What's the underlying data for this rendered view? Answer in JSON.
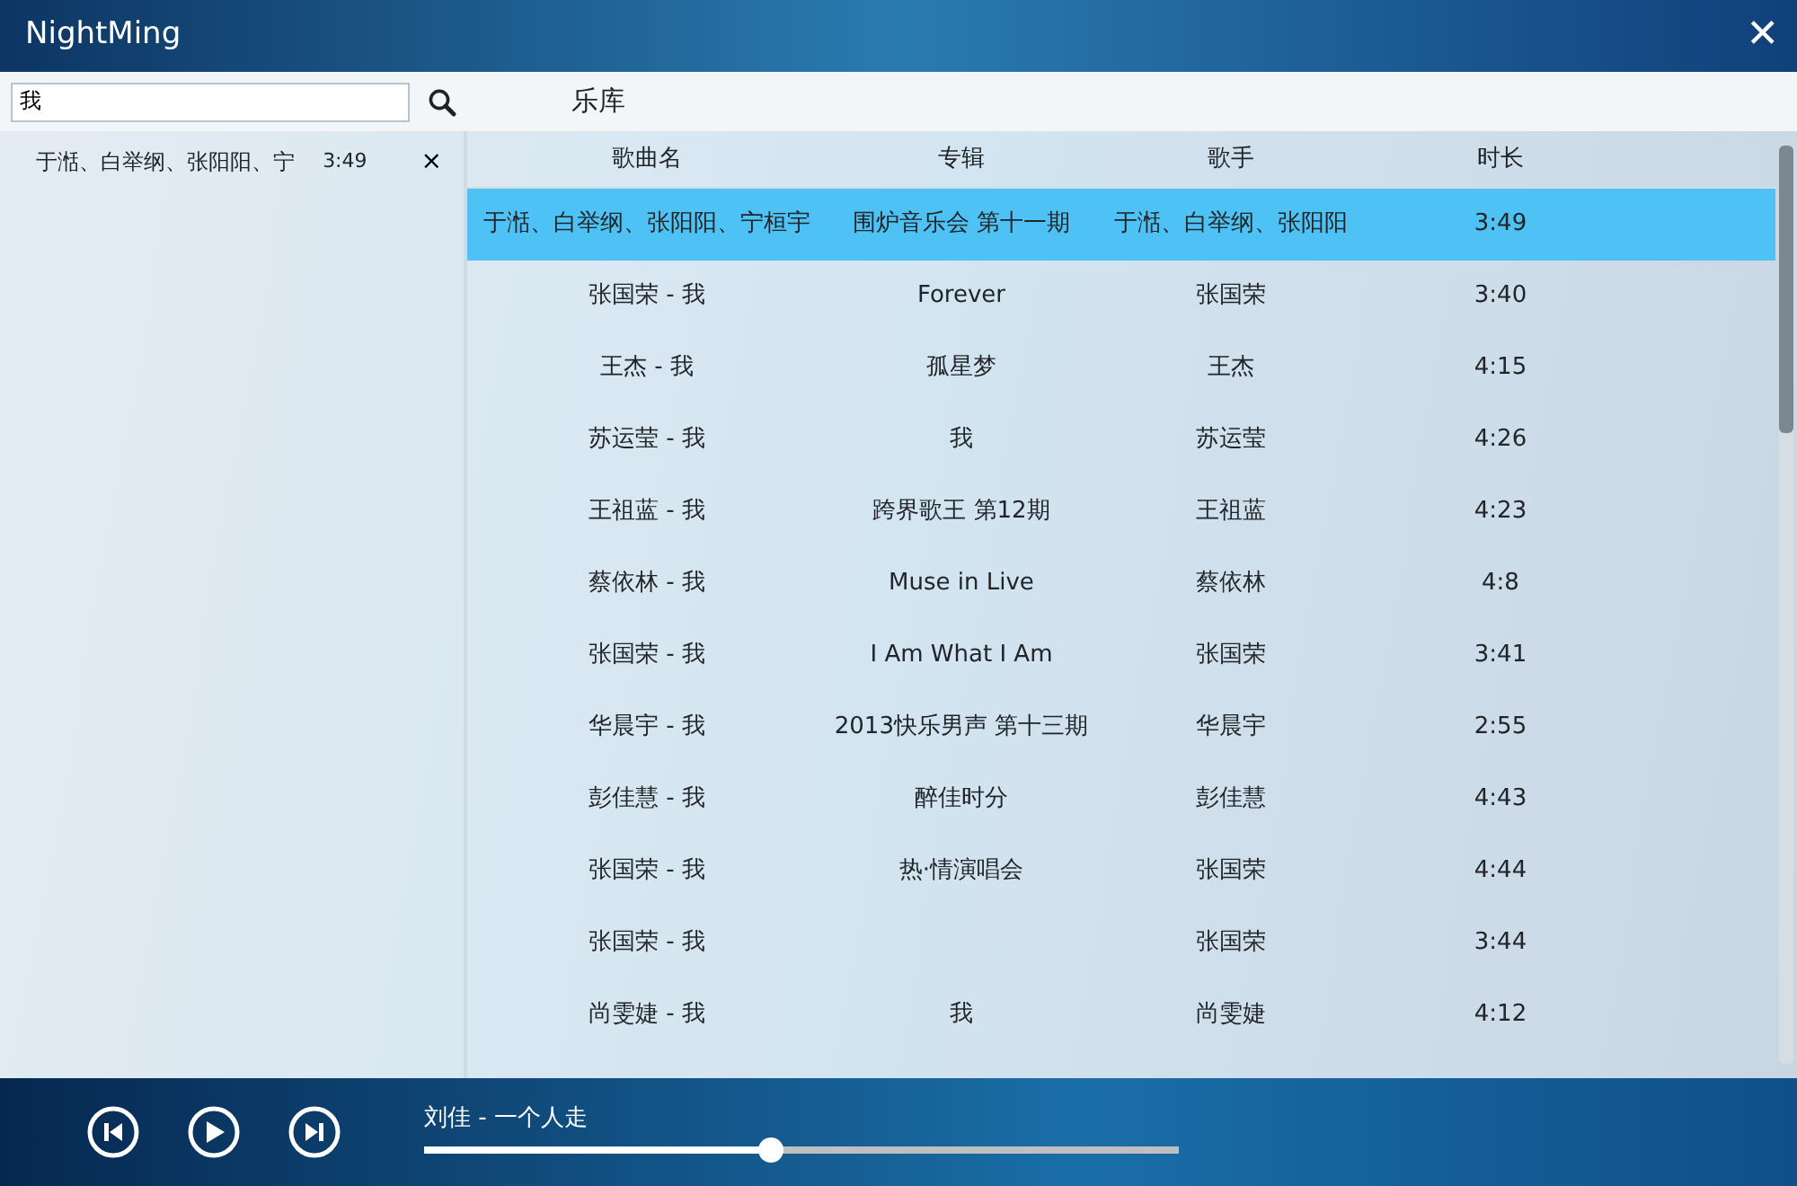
{
  "window": {
    "title": "NightMing",
    "close": "✕"
  },
  "search": {
    "value": "我"
  },
  "section_title": "乐库",
  "playlist": [
    {
      "title": "于湉、白举纲、张阳阳、宁",
      "duration": "3:49",
      "remove": "×"
    }
  ],
  "table": {
    "columns": [
      "歌曲名",
      "专辑",
      "歌手",
      "时长"
    ],
    "rows": [
      {
        "cells": [
          "于湉、白举纲、张阳阳、宁桓宇",
          "围炉音乐会 第十一期",
          "于湉、白举纲、张阳阳",
          "3:49"
        ],
        "selected": true
      },
      {
        "cells": [
          "张国荣 - 我",
          "Forever",
          "张国荣",
          "3:40"
        ],
        "selected": false
      },
      {
        "cells": [
          "王杰 - 我",
          "孤星梦",
          "王杰",
          "4:15"
        ],
        "selected": false
      },
      {
        "cells": [
          "苏运莹 - 我",
          "我",
          "苏运莹",
          "4:26"
        ],
        "selected": false
      },
      {
        "cells": [
          "王祖蓝 - 我",
          "跨界歌王 第12期",
          "王祖蓝",
          "4:23"
        ],
        "selected": false
      },
      {
        "cells": [
          "蔡依林 - 我",
          "Muse in Live",
          "蔡依林",
          "4:8"
        ],
        "selected": false
      },
      {
        "cells": [
          "张国荣 - 我",
          "I Am What I Am",
          "张国荣",
          "3:41"
        ],
        "selected": false
      },
      {
        "cells": [
          "华晨宇 - 我",
          "2013快乐男声  第十三期",
          "华晨宇",
          "2:55"
        ],
        "selected": false
      },
      {
        "cells": [
          "彭佳慧 - 我",
          "醉佳时分",
          "彭佳慧",
          "4:43"
        ],
        "selected": false
      },
      {
        "cells": [
          "张国荣 - 我",
          "热·情演唱会",
          "张国荣",
          "4:44"
        ],
        "selected": false
      },
      {
        "cells": [
          "张国荣 - 我",
          "",
          "张国荣",
          "3:44"
        ],
        "selected": false
      },
      {
        "cells": [
          "尚雯婕 - 我",
          "我",
          "尚雯婕",
          "4:12"
        ],
        "selected": false
      }
    ]
  },
  "player": {
    "now_playing": "刘佳 - 一个人走",
    "level": 0.46
  }
}
